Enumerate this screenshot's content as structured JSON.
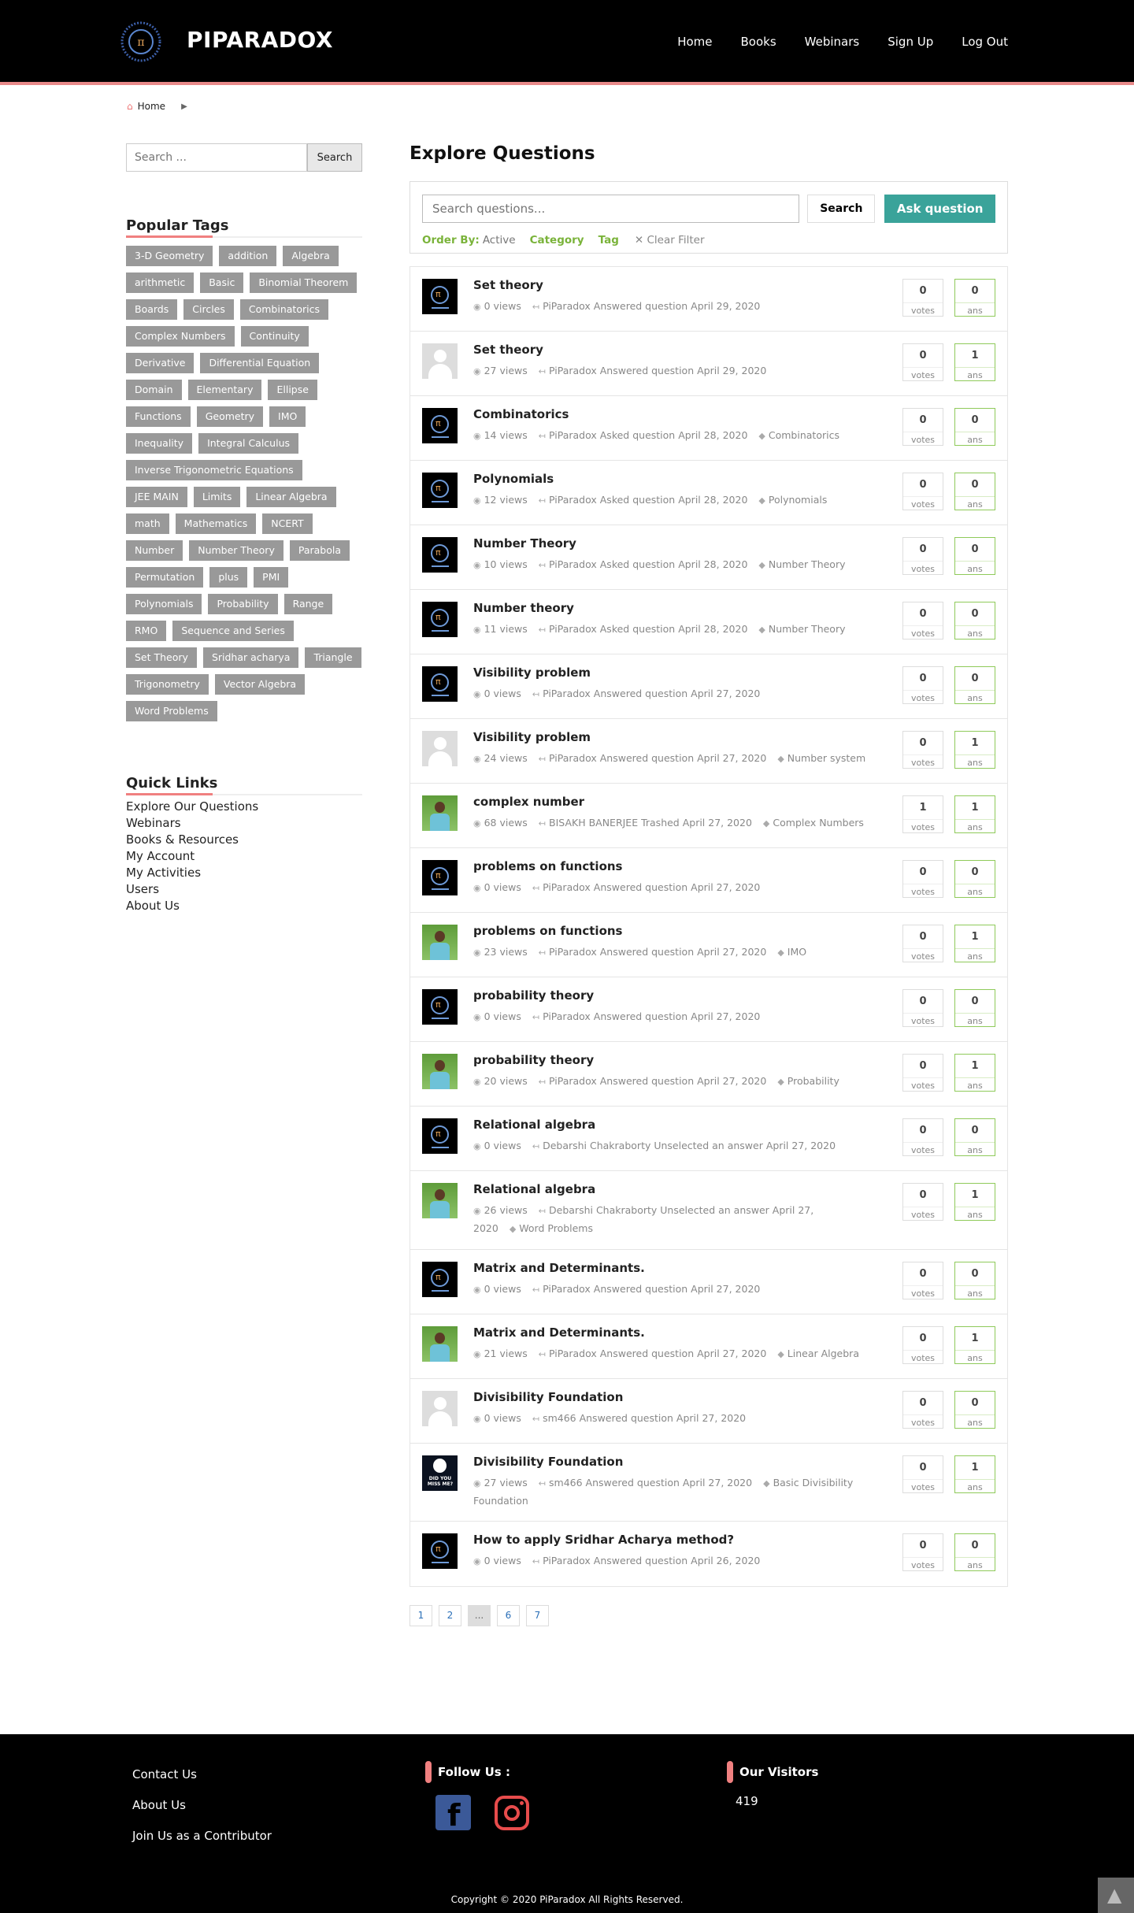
{
  "header": {
    "logo_text": "PIPARADOX",
    "nav": [
      "Home",
      "Books",
      "Webinars",
      "Sign Up",
      "Log Out"
    ]
  },
  "breadcrumb": {
    "home": "Home"
  },
  "sidebar": {
    "search_placeholder": "Search ...",
    "search_button": "Search",
    "popular_tags_heading": "Popular Tags",
    "tags": [
      "3-D Geometry",
      "addition",
      "Algebra",
      "arithmetic",
      "Basic",
      "Binomial Theorem",
      "Boards",
      "Circles",
      "Combinatorics",
      "Complex Numbers",
      "Continuity",
      "Derivative",
      "Differential Equation",
      "Domain",
      "Elementary",
      "Ellipse",
      "Functions",
      "Geometry",
      "IMO",
      "Inequality",
      "Integral Calculus",
      "Inverse Trigonometric Equations",
      "JEE MAIN",
      "Limits",
      "Linear Algebra",
      "math",
      "Mathematics",
      "NCERT",
      "Number",
      "Number Theory",
      "Parabola",
      "Permutation",
      "plus",
      "PMI",
      "Polynomials",
      "Probability",
      "Range",
      "RMO",
      "Sequence and Series",
      "Set Theory",
      "Sridhar acharya",
      "Triangle",
      "Trigonometry",
      "Vector Algebra",
      "Word Problems"
    ],
    "quick_links_heading": "Quick Links",
    "quick_links": [
      "Explore Our Questions",
      "Webinars",
      "Books & Resources",
      "My Account",
      "My Activities",
      "Users",
      "About Us"
    ]
  },
  "main": {
    "title": "Explore Questions",
    "search_placeholder": "Search questions...",
    "search_button": "Search",
    "ask_button": "Ask question",
    "order_by_label": "Order By:",
    "order_by_value": "Active",
    "category_label": "Category",
    "tag_label": "Tag",
    "clear_filter": "Clear Filter",
    "votes_label": "votes",
    "ans_label": "ans",
    "questions": [
      {
        "title": "Set theory",
        "views": "0 views",
        "activity": "PiParadox Answered question April 29, 2020",
        "tag": "",
        "votes": "0",
        "ans": "0",
        "avatar": "logo"
      },
      {
        "title": "Set theory",
        "views": "27 views",
        "activity": "PiParadox Answered question April 29, 2020",
        "tag": "",
        "votes": "0",
        "ans": "1",
        "avatar": "default"
      },
      {
        "title": "Combinatorics",
        "views": "14 views",
        "activity": "PiParadox Asked question April 28, 2020",
        "tag": "Combinatorics",
        "votes": "0",
        "ans": "0",
        "avatar": "logo"
      },
      {
        "title": "Polynomials",
        "views": "12 views",
        "activity": "PiParadox Asked question April 28, 2020",
        "tag": "Polynomials",
        "votes": "0",
        "ans": "0",
        "avatar": "logo"
      },
      {
        "title": "Number Theory",
        "views": "10 views",
        "activity": "PiParadox Asked question April 28, 2020",
        "tag": "Number Theory",
        "votes": "0",
        "ans": "0",
        "avatar": "logo"
      },
      {
        "title": "Number theory",
        "views": "11 views",
        "activity": "PiParadox Asked question April 28, 2020",
        "tag": "Number Theory",
        "votes": "0",
        "ans": "0",
        "avatar": "logo"
      },
      {
        "title": "Visibility problem",
        "views": "0 views",
        "activity": "PiParadox Answered question April 27, 2020",
        "tag": "",
        "votes": "0",
        "ans": "0",
        "avatar": "logo"
      },
      {
        "title": "Visibility problem",
        "views": "24 views",
        "activity": "PiParadox Answered question April 27, 2020",
        "tag": "Number system",
        "votes": "0",
        "ans": "1",
        "avatar": "default"
      },
      {
        "title": "complex number",
        "views": "68 views",
        "activity": "BISAKH BANERJEE Trashed April 27, 2020",
        "tag": "Complex Numbers",
        "votes": "1",
        "ans": "1",
        "avatar": "photo"
      },
      {
        "title": "problems on functions",
        "views": "0 views",
        "activity": "PiParadox Answered question April 27, 2020",
        "tag": "",
        "votes": "0",
        "ans": "0",
        "avatar": "logo"
      },
      {
        "title": "problems on functions",
        "views": "23 views",
        "activity": "PiParadox Answered question April 27, 2020",
        "tag": "IMO",
        "votes": "0",
        "ans": "1",
        "avatar": "photo"
      },
      {
        "title": "probability theory",
        "views": "0 views",
        "activity": "PiParadox Answered question April 27, 2020",
        "tag": "",
        "votes": "0",
        "ans": "0",
        "avatar": "logo"
      },
      {
        "title": "probability theory",
        "views": "20 views",
        "activity": "PiParadox Answered question April 27, 2020",
        "tag": "Probability",
        "votes": "0",
        "ans": "1",
        "avatar": "photo"
      },
      {
        "title": "Relational algebra",
        "views": "0 views",
        "activity": "Debarshi Chakraborty Unselected an answer April 27, 2020",
        "tag": "",
        "votes": "0",
        "ans": "0",
        "avatar": "logo"
      },
      {
        "title": "Relational algebra",
        "views": "26 views",
        "activity": "Debarshi Chakraborty Unselected an answer April 27, 2020",
        "tag": "Word Problems",
        "votes": "0",
        "ans": "1",
        "avatar": "photo"
      },
      {
        "title": "Matrix and Determinants.",
        "views": "0 views",
        "activity": "PiParadox Answered question April 27, 2020",
        "tag": "",
        "votes": "0",
        "ans": "0",
        "avatar": "logo"
      },
      {
        "title": "Matrix and Determinants.",
        "views": "21 views",
        "activity": "PiParadox Answered question April 27, 2020",
        "tag": "Linear Algebra",
        "votes": "0",
        "ans": "1",
        "avatar": "photo"
      },
      {
        "title": "Divisibility Foundation",
        "views": "0 views",
        "activity": "sm466 Answered question April 27, 2020",
        "tag": "",
        "votes": "0",
        "ans": "0",
        "avatar": "default"
      },
      {
        "title": "Divisibility Foundation",
        "views": "27 views",
        "activity": "sm466 Answered question April 27, 2020",
        "tag": "Basic Divisibility Foundation",
        "votes": "0",
        "ans": "1",
        "avatar": "dym",
        "avatar_text": "DID YOU MISS ME?"
      },
      {
        "title": "How to apply Sridhar Acharya method?",
        "views": "0 views",
        "activity": "PiParadox Answered question April 26, 2020",
        "tag": "",
        "votes": "0",
        "ans": "0",
        "avatar": "logo"
      }
    ],
    "pagination": [
      "1",
      "2",
      "...",
      "6",
      "7"
    ]
  },
  "footer": {
    "links": [
      "Contact Us",
      "About Us",
      "Join Us as a Contributor"
    ],
    "follow_heading": "Follow Us :",
    "visitors_heading": "Our Visitors",
    "visitors_count": "419",
    "copyright": "Copyright © 2020 PiParadox All Rights Reserved."
  },
  "colors": {
    "accent": "#3aa39a",
    "tag_bg": "#999999",
    "highlight": "#f08080",
    "filter_green": "#7ab33a"
  }
}
